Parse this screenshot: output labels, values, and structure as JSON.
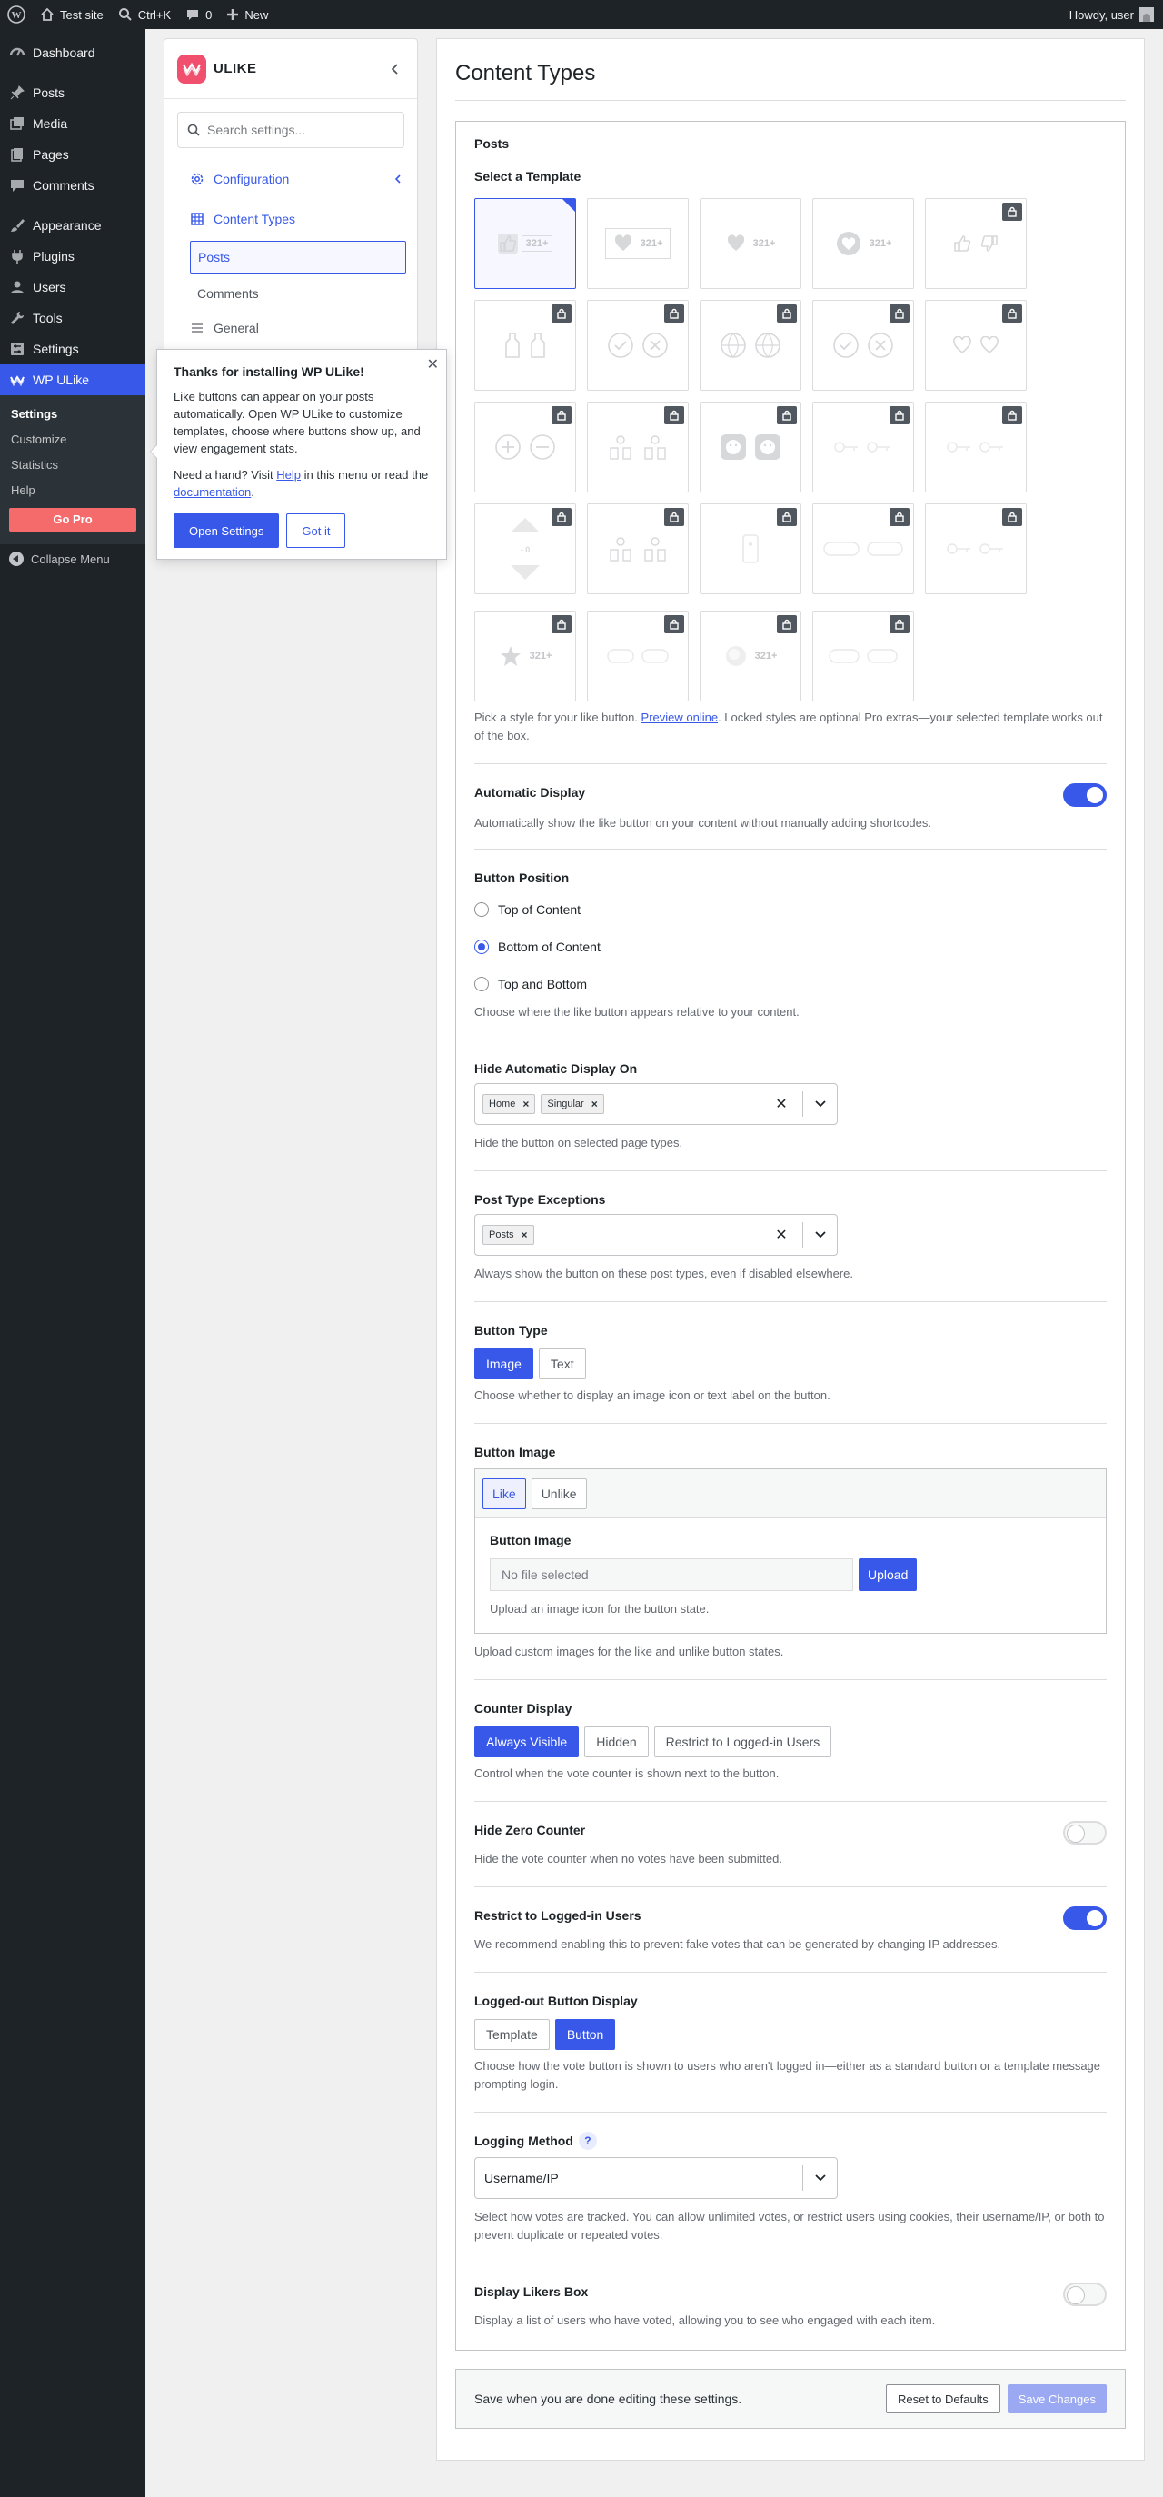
{
  "adminbar": {
    "site": "Test site",
    "search_shortcut": "Ctrl+K",
    "comments_count": "0",
    "new_label": "New",
    "howdy": "Howdy, user"
  },
  "adminmenu": {
    "items": [
      {
        "label": "Dashboard",
        "icon": "dashboard-icon"
      },
      {
        "label": "Posts",
        "icon": "pin-icon"
      },
      {
        "label": "Media",
        "icon": "media-icon"
      },
      {
        "label": "Pages",
        "icon": "pages-icon"
      },
      {
        "label": "Comments",
        "icon": "comment-icon"
      },
      {
        "label": "Appearance",
        "icon": "brush-icon"
      },
      {
        "label": "Plugins",
        "icon": "plug-icon"
      },
      {
        "label": "Users",
        "icon": "user-icon"
      },
      {
        "label": "Tools",
        "icon": "wrench-icon"
      },
      {
        "label": "Settings",
        "icon": "sliders-icon"
      },
      {
        "label": "WP ULike",
        "icon": "ulike-icon"
      }
    ],
    "submenu": [
      "Settings",
      "Customize",
      "Statistics",
      "Help"
    ],
    "go_pro": "Go Pro",
    "collapse": "Collapse Menu"
  },
  "nav": {
    "brand": "ULIKE",
    "search_placeholder": "Search settings...",
    "configuration": "Configuration",
    "content_types": "Content Types",
    "posts": "Posts",
    "comments": "Comments",
    "general": "General"
  },
  "popup": {
    "title": "Thanks for installing WP ULike!",
    "body": "Like buttons can appear on your posts automatically. Open WP ULike to customize templates, choose where buttons show up, and view engagement stats.",
    "help_pre": "Need a hand? Visit ",
    "help_link": "Help",
    "help_mid": " in this menu or read the ",
    "doc_link": "documentation",
    "help_end": ".",
    "open_settings": "Open Settings",
    "got_it": "Got it"
  },
  "page": {
    "title": "Content Types",
    "box_title": "Posts",
    "select_template": "Select a Template",
    "template_count_label": "321+",
    "template_desc_pre": "Pick a style for your like button. ",
    "template_desc_link": "Preview online",
    "template_desc_post": ". Locked styles are optional Pro extras—your selected template works out of the box.",
    "auto_display": {
      "label": "Automatic Display",
      "desc": "Automatically show the like button on your content without manually adding shortcodes.",
      "on": true
    },
    "position": {
      "label": "Button Position",
      "options": [
        "Top of Content",
        "Bottom of Content",
        "Top and Bottom"
      ],
      "selected": "Bottom of Content",
      "desc": "Choose where the like button appears relative to your content."
    },
    "hide_auto": {
      "label": "Hide Automatic Display On",
      "chips": [
        "Home",
        "Singular"
      ],
      "desc": "Hide the button on selected page types."
    },
    "exceptions": {
      "label": "Post Type Exceptions",
      "chips": [
        "Posts"
      ],
      "desc": "Always show the button on these post types, even if disabled elsewhere."
    },
    "button_type": {
      "label": "Button Type",
      "options": [
        "Image",
        "Text"
      ],
      "selected": "Image",
      "desc": "Choose whether to display an image icon or text label on the button."
    },
    "button_image": {
      "label": "Button Image",
      "tabs": [
        "Like",
        "Unlike"
      ],
      "inner_label": "Button Image",
      "file_placeholder": "No file selected",
      "upload": "Upload",
      "inner_desc": "Upload an image icon for the button state.",
      "desc": "Upload custom images for the like and unlike button states."
    },
    "counter": {
      "label": "Counter Display",
      "options": [
        "Always Visible",
        "Hidden",
        "Restrict to Logged-in Users"
      ],
      "selected": "Always Visible",
      "desc": "Control when the vote counter is shown next to the button."
    },
    "hide_zero": {
      "label": "Hide Zero Counter",
      "desc": "Hide the vote counter when no votes have been submitted.",
      "on": false
    },
    "restrict": {
      "label": "Restrict to Logged-in Users",
      "desc": "We recommend enabling this to prevent fake votes that can be generated by changing IP addresses.",
      "on": true
    },
    "logged_out": {
      "label": "Logged-out Button Display",
      "options": [
        "Template",
        "Button"
      ],
      "selected": "Button",
      "desc": "Choose how the vote button is shown to users who aren't logged in—either as a standard button or a template message prompting login."
    },
    "logging": {
      "label": "Logging Method",
      "help": "?",
      "value": "Username/IP",
      "desc": "Select how votes are tracked. You can allow unlimited votes, or restrict users using cookies, their username/IP, or both to prevent duplicate or repeated votes."
    },
    "likers": {
      "label": "Display Likers Box",
      "desc": "Display a list of users who have voted, allowing you to see who engaged with each item.",
      "on": false
    }
  },
  "savebar": {
    "text": "Save when you are done editing these settings.",
    "reset": "Reset to Defaults",
    "save": "Save Changes"
  },
  "colors": {
    "accent": "#3858e9",
    "admin_dark": "#1d2327",
    "go_pro": "#f56b6b"
  }
}
